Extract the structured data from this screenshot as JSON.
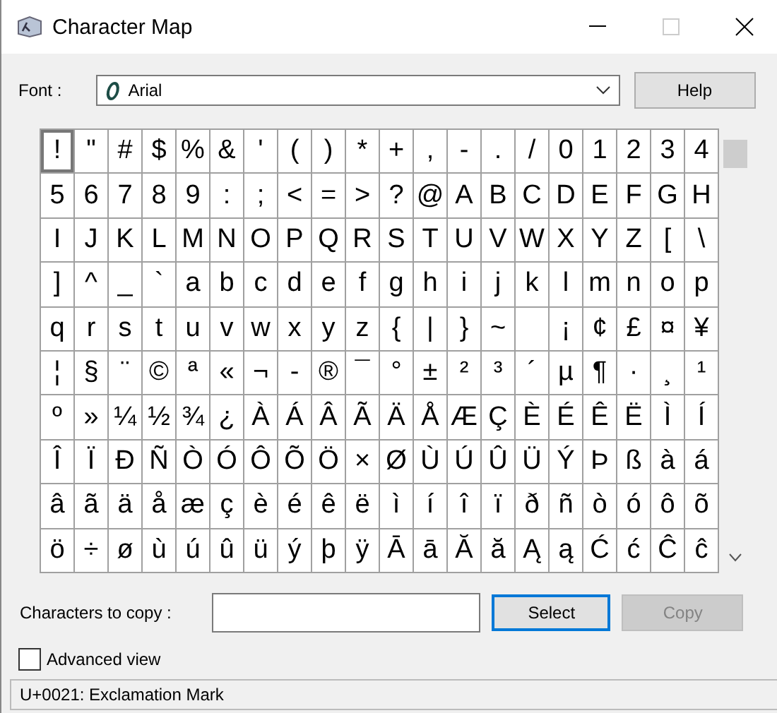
{
  "window": {
    "title": "Character Map"
  },
  "font": {
    "label": "Font :",
    "value": "Arial"
  },
  "help_button": "Help",
  "grid": {
    "rows": [
      [
        {
          "char": "!",
          "selected": true
        },
        {
          "char": "\"",
          "selected": false
        },
        {
          "char": "#",
          "selected": false
        },
        {
          "char": "$",
          "selected": false
        },
        {
          "char": "%",
          "selected": false
        },
        {
          "char": "&",
          "selected": false
        },
        {
          "char": "'",
          "selected": false
        },
        {
          "char": "(",
          "selected": false
        },
        {
          "char": ")",
          "selected": false
        },
        {
          "char": "*",
          "selected": false
        },
        {
          "char": "+",
          "selected": false
        },
        {
          "char": ",",
          "selected": false
        },
        {
          "char": "-",
          "selected": false
        },
        {
          "char": ".",
          "selected": false
        },
        {
          "char": "/",
          "selected": false
        },
        {
          "char": "0",
          "selected": false
        },
        {
          "char": "1",
          "selected": false
        },
        {
          "char": "2",
          "selected": false
        },
        {
          "char": "3",
          "selected": false
        },
        {
          "char": "4",
          "selected": false
        }
      ],
      [
        {
          "char": "5",
          "selected": false
        },
        {
          "char": "6",
          "selected": false
        },
        {
          "char": "7",
          "selected": false
        },
        {
          "char": "8",
          "selected": false
        },
        {
          "char": "9",
          "selected": false
        },
        {
          "char": ":",
          "selected": false
        },
        {
          "char": ";",
          "selected": false
        },
        {
          "char": "<",
          "selected": false
        },
        {
          "char": "=",
          "selected": false
        },
        {
          "char": ">",
          "selected": false
        },
        {
          "char": "?",
          "selected": false
        },
        {
          "char": "@",
          "selected": false
        },
        {
          "char": "A",
          "selected": false
        },
        {
          "char": "B",
          "selected": false
        },
        {
          "char": "C",
          "selected": false
        },
        {
          "char": "D",
          "selected": false
        },
        {
          "char": "E",
          "selected": false
        },
        {
          "char": "F",
          "selected": false
        },
        {
          "char": "G",
          "selected": false
        },
        {
          "char": "H",
          "selected": false
        }
      ],
      [
        {
          "char": "I",
          "selected": false
        },
        {
          "char": "J",
          "selected": false
        },
        {
          "char": "K",
          "selected": false
        },
        {
          "char": "L",
          "selected": false
        },
        {
          "char": "M",
          "selected": false
        },
        {
          "char": "N",
          "selected": false
        },
        {
          "char": "O",
          "selected": false
        },
        {
          "char": "P",
          "selected": false
        },
        {
          "char": "Q",
          "selected": false
        },
        {
          "char": "R",
          "selected": false
        },
        {
          "char": "S",
          "selected": false
        },
        {
          "char": "T",
          "selected": false
        },
        {
          "char": "U",
          "selected": false
        },
        {
          "char": "V",
          "selected": false
        },
        {
          "char": "W",
          "selected": false
        },
        {
          "char": "X",
          "selected": false
        },
        {
          "char": "Y",
          "selected": false
        },
        {
          "char": "Z",
          "selected": false
        },
        {
          "char": "[",
          "selected": false
        },
        {
          "char": "\\",
          "selected": false
        }
      ],
      [
        {
          "char": "]",
          "selected": false
        },
        {
          "char": "^",
          "selected": false
        },
        {
          "char": "_",
          "selected": false
        },
        {
          "char": "`",
          "selected": false
        },
        {
          "char": "a",
          "selected": false
        },
        {
          "char": "b",
          "selected": false
        },
        {
          "char": "c",
          "selected": false
        },
        {
          "char": "d",
          "selected": false
        },
        {
          "char": "e",
          "selected": false
        },
        {
          "char": "f",
          "selected": false
        },
        {
          "char": "g",
          "selected": false
        },
        {
          "char": "h",
          "selected": false
        },
        {
          "char": "i",
          "selected": false
        },
        {
          "char": "j",
          "selected": false
        },
        {
          "char": "k",
          "selected": false
        },
        {
          "char": "l",
          "selected": false
        },
        {
          "char": "m",
          "selected": false
        },
        {
          "char": "n",
          "selected": false
        },
        {
          "char": "o",
          "selected": false
        },
        {
          "char": "p",
          "selected": false
        }
      ],
      [
        {
          "char": "q",
          "selected": false
        },
        {
          "char": "r",
          "selected": false
        },
        {
          "char": "s",
          "selected": false
        },
        {
          "char": "t",
          "selected": false
        },
        {
          "char": "u",
          "selected": false
        },
        {
          "char": "v",
          "selected": false
        },
        {
          "char": "w",
          "selected": false
        },
        {
          "char": "x",
          "selected": false
        },
        {
          "char": "y",
          "selected": false
        },
        {
          "char": "z",
          "selected": false
        },
        {
          "char": "{",
          "selected": false
        },
        {
          "char": "|",
          "selected": false
        },
        {
          "char": "}",
          "selected": false
        },
        {
          "char": "~",
          "selected": false
        },
        {
          "selected": false
        },
        {
          "char": "¡",
          "selected": false
        },
        {
          "char": "¢",
          "selected": false
        },
        {
          "char": "£",
          "selected": false
        },
        {
          "char": "¤",
          "selected": false
        },
        {
          "char": "¥",
          "selected": false
        }
      ],
      [
        {
          "char": "¦",
          "selected": false
        },
        {
          "char": "§",
          "selected": false
        },
        {
          "char": "¨",
          "selected": false
        },
        {
          "char": "©",
          "selected": false
        },
        {
          "char": "ª",
          "selected": false
        },
        {
          "char": "«",
          "selected": false
        },
        {
          "char": "¬",
          "selected": false
        },
        {
          "char": "-",
          "selected": false
        },
        {
          "char": "®",
          "selected": false
        },
        {
          "char": "¯",
          "selected": false
        },
        {
          "char": "°",
          "selected": false
        },
        {
          "char": "±",
          "selected": false
        },
        {
          "char": "²",
          "selected": false
        },
        {
          "char": "³",
          "selected": false
        },
        {
          "char": "´",
          "selected": false
        },
        {
          "char": "µ",
          "selected": false
        },
        {
          "char": "¶",
          "selected": false
        },
        {
          "char": "·",
          "selected": false
        },
        {
          "char": "¸",
          "selected": false
        },
        {
          "char": "¹",
          "selected": false
        }
      ],
      [
        {
          "char": "º",
          "selected": false
        },
        {
          "char": "»",
          "selected": false
        },
        {
          "char": "¼",
          "selected": false
        },
        {
          "char": "½",
          "selected": false
        },
        {
          "char": "¾",
          "selected": false
        },
        {
          "char": "¿",
          "selected": false
        },
        {
          "char": "À",
          "selected": false
        },
        {
          "char": "Á",
          "selected": false
        },
        {
          "char": "Â",
          "selected": false
        },
        {
          "char": "Ã",
          "selected": false
        },
        {
          "char": "Ä",
          "selected": false
        },
        {
          "char": "Å",
          "selected": false
        },
        {
          "char": "Æ",
          "selected": false
        },
        {
          "char": "Ç",
          "selected": false
        },
        {
          "char": "È",
          "selected": false
        },
        {
          "char": "É",
          "selected": false
        },
        {
          "char": "Ê",
          "selected": false
        },
        {
          "char": "Ë",
          "selected": false
        },
        {
          "char": "Ì",
          "selected": false
        },
        {
          "char": "Í",
          "selected": false
        }
      ],
      [
        {
          "char": "Î",
          "selected": false
        },
        {
          "char": "Ï",
          "selected": false
        },
        {
          "char": "Ð",
          "selected": false
        },
        {
          "char": "Ñ",
          "selected": false
        },
        {
          "char": "Ò",
          "selected": false
        },
        {
          "char": "Ó",
          "selected": false
        },
        {
          "char": "Ô",
          "selected": false
        },
        {
          "char": "Õ",
          "selected": false
        },
        {
          "char": "Ö",
          "selected": false
        },
        {
          "char": "×",
          "selected": false
        },
        {
          "char": "Ø",
          "selected": false
        },
        {
          "char": "Ù",
          "selected": false
        },
        {
          "char": "Ú",
          "selected": false
        },
        {
          "char": "Û",
          "selected": false
        },
        {
          "char": "Ü",
          "selected": false
        },
        {
          "char": "Ý",
          "selected": false
        },
        {
          "char": "Þ",
          "selected": false
        },
        {
          "char": "ß",
          "selected": false
        },
        {
          "char": "à",
          "selected": false
        },
        {
          "char": "á",
          "selected": false
        }
      ],
      [
        {
          "char": "â",
          "selected": false
        },
        {
          "char": "ã",
          "selected": false
        },
        {
          "char": "ä",
          "selected": false
        },
        {
          "char": "å",
          "selected": false
        },
        {
          "char": "æ",
          "selected": false
        },
        {
          "char": "ç",
          "selected": false
        },
        {
          "char": "è",
          "selected": false
        },
        {
          "char": "é",
          "selected": false
        },
        {
          "char": "ê",
          "selected": false
        },
        {
          "char": "ë",
          "selected": false
        },
        {
          "char": "ì",
          "selected": false
        },
        {
          "char": "í",
          "selected": false
        },
        {
          "char": "î",
          "selected": false
        },
        {
          "char": "ï",
          "selected": false
        },
        {
          "char": "ð",
          "selected": false
        },
        {
          "char": "ñ",
          "selected": false
        },
        {
          "char": "ò",
          "selected": false
        },
        {
          "char": "ó",
          "selected": false
        },
        {
          "char": "ô",
          "selected": false
        },
        {
          "char": "õ",
          "selected": false
        }
      ],
      [
        {
          "char": "ö",
          "selected": false
        },
        {
          "char": "÷",
          "selected": false
        },
        {
          "char": "ø",
          "selected": false
        },
        {
          "char": "ù",
          "selected": false
        },
        {
          "char": "ú",
          "selected": false
        },
        {
          "char": "û",
          "selected": false
        },
        {
          "char": "ü",
          "selected": false
        },
        {
          "char": "ý",
          "selected": false
        },
        {
          "char": "þ",
          "selected": false
        },
        {
          "char": "ÿ",
          "selected": false
        },
        {
          "char": "Ā",
          "selected": false
        },
        {
          "char": "ā",
          "selected": false
        },
        {
          "char": "Ă",
          "selected": false
        },
        {
          "char": "ă",
          "selected": false
        },
        {
          "char": "Ą",
          "selected": false
        },
        {
          "char": "ą",
          "selected": false
        },
        {
          "char": "Ć",
          "selected": false
        },
        {
          "char": "ć",
          "selected": false
        },
        {
          "char": "Ĉ",
          "selected": false
        },
        {
          "char": "ĉ",
          "selected": false
        }
      ]
    ]
  },
  "copy_row": {
    "label": "Characters to copy :",
    "select_button": "Select",
    "copy_button": {
      "label": "Copy",
      "disabled": true
    }
  },
  "advanced_view": {
    "label": "Advanced view",
    "checked": false
  },
  "status_bar": "U+0021: Exclamation Mark"
}
